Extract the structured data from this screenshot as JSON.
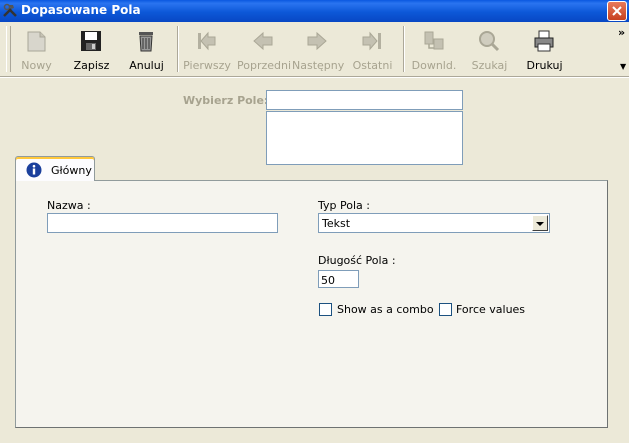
{
  "window": {
    "title": "Dopasowane Pola"
  },
  "toolbar": {
    "buttons": [
      {
        "label": "Nowy",
        "icon": "new-icon",
        "enabled": false
      },
      {
        "label": "Zapisz",
        "icon": "save-icon",
        "enabled": true
      },
      {
        "label": "Anuluj",
        "icon": "cancel-icon",
        "enabled": true
      },
      {
        "label": "Pierwszy",
        "icon": "first-icon",
        "enabled": false
      },
      {
        "label": "Poprzedni",
        "icon": "previous-icon",
        "enabled": false
      },
      {
        "label": "Następny",
        "icon": "next-icon",
        "enabled": false
      },
      {
        "label": "Ostatni",
        "icon": "last-icon",
        "enabled": false
      },
      {
        "label": "Downld.",
        "icon": "download-icon",
        "enabled": false
      },
      {
        "label": "Szukaj",
        "icon": "search-icon",
        "enabled": false
      },
      {
        "label": "Drukuj",
        "icon": "print-icon",
        "enabled": true
      }
    ],
    "overflow": "»"
  },
  "picker": {
    "label": "Wybierz Pole:",
    "value": ""
  },
  "tabs": [
    {
      "label": "Główny",
      "icon": "info-icon",
      "active": true
    }
  ],
  "form": {
    "name_label": "Nazwa :",
    "name_value": "",
    "type_label": "Typ Pola :",
    "type_value": "Tekst",
    "length_label": "Długość Pola :",
    "length_value": "50",
    "combo_label": "Show as a combo",
    "combo_checked": false,
    "force_label": "Force values",
    "force_checked": false
  }
}
